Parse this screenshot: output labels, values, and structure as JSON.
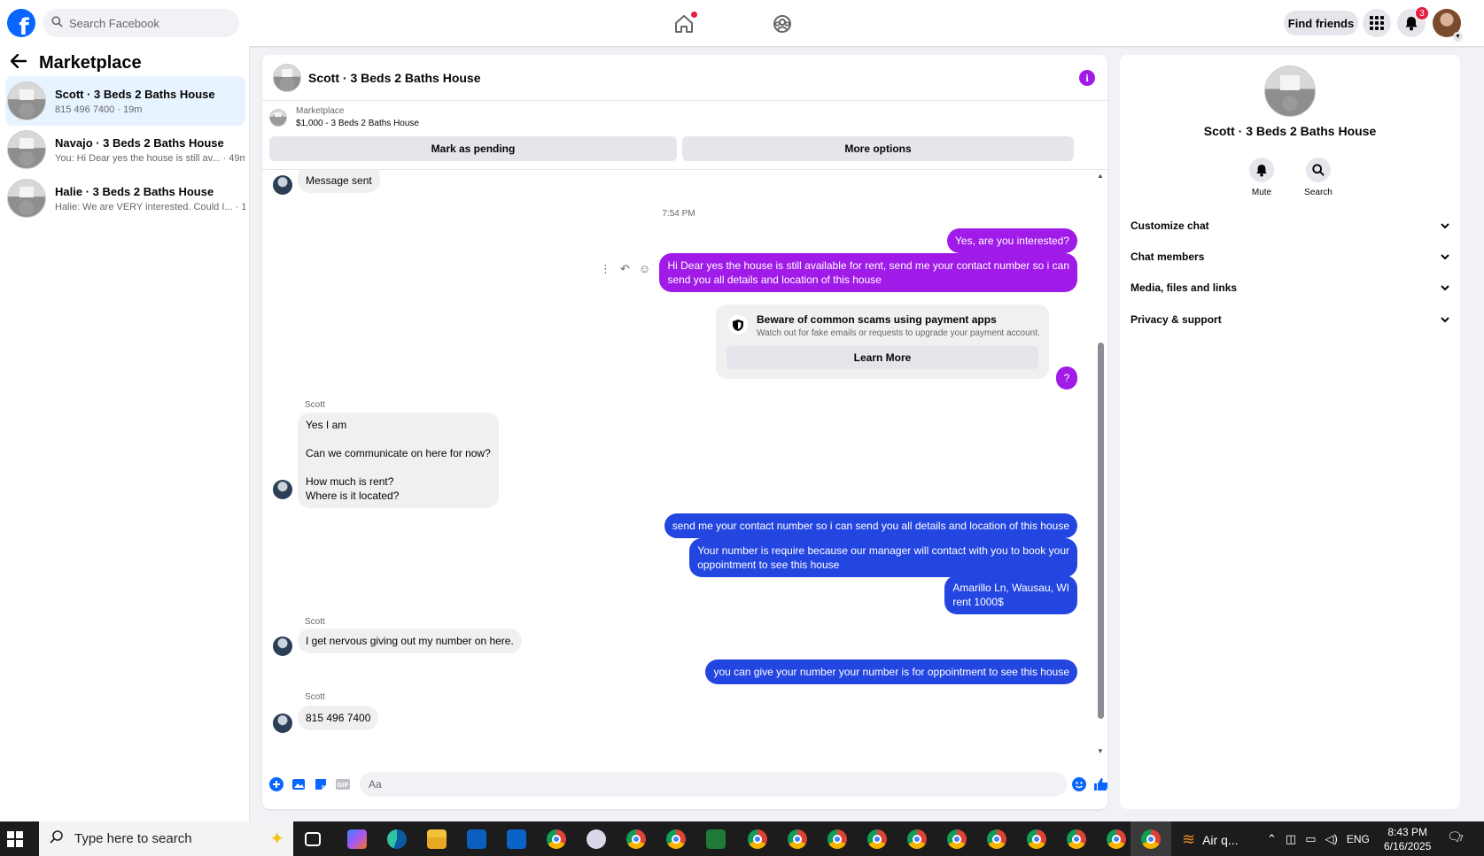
{
  "topbar": {
    "logo": "f",
    "search_placeholder": "Search Facebook",
    "find_friends": "Find friends",
    "notif_count": "3"
  },
  "sidebar": {
    "title": "Marketplace",
    "conversations": [
      {
        "title": "Scott · 3 Beds 2 Baths House",
        "subtitle": "815 496 7400 · 19m",
        "active": true
      },
      {
        "title": "Navajo · 3 Beds 2 Baths House",
        "subtitle": "You: Hi Dear yes the house is still av... · 49m",
        "active": false
      },
      {
        "title": "Halie · 3 Beds 2 Baths House",
        "subtitle": "Halie: We are VERY interested. Could I... · 1h",
        "active": false
      }
    ]
  },
  "chat": {
    "title": "Scott · 3 Beds 2 Baths House",
    "listing_source": "Marketplace",
    "listing_price": "$1,000 - 3 Beds 2 Baths House",
    "mark_pending": "Mark as pending",
    "more_options": "More options",
    "timestamp": "7:54 PM",
    "messages": {
      "m0": "Message sent",
      "m1": "Yes, are you interested?",
      "m2a": "Hi Dear yes the house is still available for rent, send me your contact number so i can",
      "m2b": "send you all details and location of this house",
      "m3": "?",
      "scott_label": "Scott",
      "m4a": "Yes I am",
      "m4b": "Can we communicate on here for now?",
      "m4c": "How much is rent?",
      "m4d": "Where is it located?",
      "m5": "send me your contact number so i can send you all details and location of this house",
      "m6a": "Your number is require because our manager will contact with you to book your",
      "m6b": "oppointment to see this house",
      "m7a": "Amarillo Ln, Wausau, WI",
      "m7b": "rent 1000$",
      "m8": "I get nervous giving out my number on here.",
      "m9": "you can give your number your number is for oppointment to see this house",
      "m10": "815 496 7400"
    },
    "scam": {
      "title": "Beware of common scams using payment apps",
      "subtitle": "Watch out for fake emails or requests to upgrade your payment account.",
      "button": "Learn More"
    },
    "composer_placeholder": "Aa"
  },
  "right_panel": {
    "title": "Scott · 3 Beds 2 Baths House",
    "mute": "Mute",
    "search": "Search",
    "rows": [
      "Customize chat",
      "Chat members",
      "Media, files and links",
      "Privacy & support"
    ]
  },
  "taskbar": {
    "search_placeholder": "Type here to search",
    "weather": "Air q...",
    "lang": "ENG",
    "time": "8:43 PM",
    "date": "6/16/2025",
    "notif_count": "7"
  },
  "colors": {
    "fb_blue": "#0866ff",
    "bubble_purple": "#a01be8",
    "bubble_blue": "#2446e0",
    "bubble_grey": "#f0f0f0"
  }
}
